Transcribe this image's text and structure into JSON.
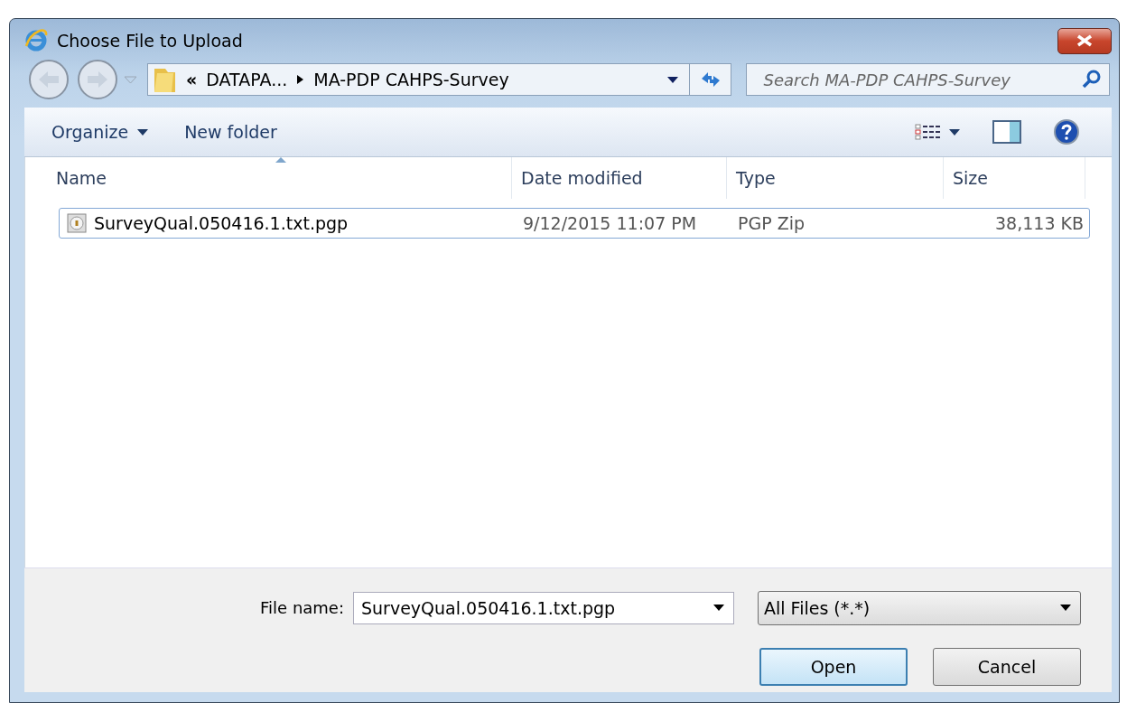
{
  "window": {
    "title": "Choose File to Upload"
  },
  "address": {
    "overflow_marker": "«",
    "crumbs": [
      "DATAPA...",
      "MA-PDP CAHPS-Survey"
    ]
  },
  "search": {
    "placeholder": "Search MA-PDP CAHPS-Survey"
  },
  "toolbar": [
    {
      "label": "Organize",
      "kind": "menu"
    },
    {
      "label": "New folder",
      "kind": "plain"
    }
  ],
  "columns": [
    {
      "label": "Name",
      "sorted": true
    },
    {
      "label": "Date modified",
      "sorted": false
    },
    {
      "label": "Type",
      "sorted": false
    },
    {
      "label": "Size",
      "sorted": false
    }
  ],
  "rows": [
    {
      "name": "SurveyQual.050416.1.txt.pgp",
      "date": "9/12/2015 11:07 PM",
      "type": "PGP Zip",
      "size": "38,113 KB",
      "selected": true
    }
  ],
  "footer": {
    "filename_label": "File name:",
    "filename": "SurveyQual.050416.1.txt.pgp",
    "filter": "All Files (*.*)",
    "buttons": [
      {
        "label": "Open",
        "default": true
      },
      {
        "label": "Cancel",
        "default": false
      }
    ]
  }
}
